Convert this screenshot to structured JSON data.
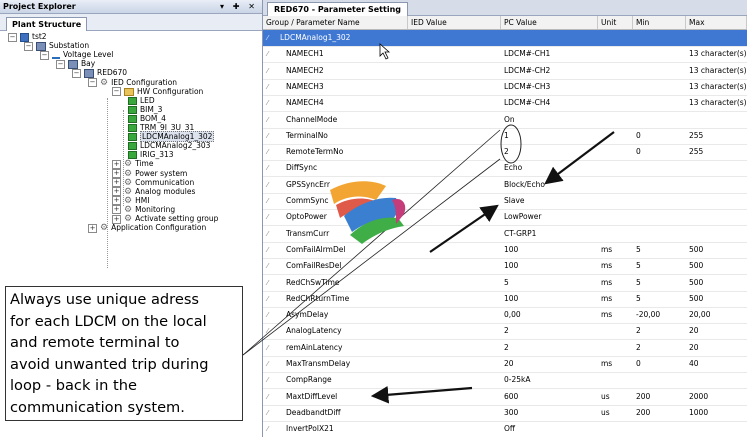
{
  "explorer": {
    "title": "Project Explorer",
    "buttons": "▾ ✚ ✕",
    "tab": "Plant Structure",
    "tree": [
      {
        "label": "tst2",
        "icon": "database-icon",
        "exp": "−"
      },
      {
        "label": "Substation",
        "icon": "substation-icon",
        "exp": "−"
      },
      {
        "label": "Voltage Level",
        "icon": "voltage-level-icon",
        "exp": "−"
      },
      {
        "label": "Bay",
        "icon": "bay-icon",
        "exp": "−"
      },
      {
        "label": "RED670",
        "icon": "ied-icon",
        "exp": "−"
      },
      {
        "label": "IED Configuration",
        "icon": "gear-icon",
        "exp": "−"
      },
      {
        "label": "HW Configuration",
        "icon": "hw-config-icon",
        "exp": "−"
      },
      {
        "label": "LED",
        "icon": "module-icon"
      },
      {
        "label": "BIM_3",
        "icon": "module-icon"
      },
      {
        "label": "BOM_4",
        "icon": "module-icon"
      },
      {
        "label": "TRM_9I_3U_31",
        "icon": "module-icon"
      },
      {
        "label": "LDCMAnalog1_302",
        "icon": "module-icon",
        "selected": true
      },
      {
        "label": "LDCMAnalog2_303",
        "icon": "module-icon"
      },
      {
        "label": "IRIG_313",
        "icon": "module-icon"
      },
      {
        "label": "Time",
        "icon": "gear-icon",
        "exp": "+"
      },
      {
        "label": "Power system",
        "icon": "gear-icon",
        "exp": "+"
      },
      {
        "label": "Communication",
        "icon": "gear-icon",
        "exp": "+"
      },
      {
        "label": "Analog modules",
        "icon": "gear-icon",
        "exp": "+"
      },
      {
        "label": "HMI",
        "icon": "gear-icon",
        "exp": "+"
      },
      {
        "label": "Monitoring",
        "icon": "gear-icon",
        "exp": "+"
      },
      {
        "label": "Activate setting group",
        "icon": "gear-icon",
        "exp": "+"
      },
      {
        "label": "Application Configuration",
        "icon": "gear-icon",
        "exp": "+"
      }
    ]
  },
  "editor": {
    "tab": "RED670 - Parameter Setting",
    "columns": [
      "Group / Parameter Name",
      "IED Value",
      "PC Value",
      "Unit",
      "Min",
      "Max"
    ],
    "group": "LDCMAnalog1_302",
    "rows": [
      [
        "NAMECH1",
        "",
        "LDCM#-CH1",
        "",
        "",
        "13 character(s)"
      ],
      [
        "NAMECH2",
        "",
        "LDCM#-CH2",
        "",
        "",
        "13 character(s)"
      ],
      [
        "NAMECH3",
        "",
        "LDCM#-CH3",
        "",
        "",
        "13 character(s)"
      ],
      [
        "NAMECH4",
        "",
        "LDCM#-CH4",
        "",
        "",
        "13 character(s)"
      ],
      [
        "ChannelMode",
        "",
        "On",
        "",
        "",
        ""
      ],
      [
        "TerminalNo",
        "",
        "1",
        "",
        "0",
        "255"
      ],
      [
        "RemoteTermNo",
        "",
        "2",
        "",
        "0",
        "255"
      ],
      [
        "DiffSync",
        "",
        "Echo",
        "",
        "",
        ""
      ],
      [
        "GPSSyncErr",
        "",
        "Block/Echo",
        "",
        "",
        ""
      ],
      [
        "CommSync",
        "",
        "Slave",
        "",
        "",
        ""
      ],
      [
        "OptoPower",
        "",
        "LowPower",
        "",
        "",
        ""
      ],
      [
        "TransmCurr",
        "",
        "CT-GRP1",
        "",
        "",
        ""
      ],
      [
        "ComFailAlrmDel",
        "",
        "100",
        "ms",
        "5",
        "500"
      ],
      [
        "ComFailResDel",
        "",
        "100",
        "ms",
        "5",
        "500"
      ],
      [
        "RedChSwTime",
        "",
        "5",
        "ms",
        "5",
        "500"
      ],
      [
        "RedChRturnTime",
        "",
        "100",
        "ms",
        "5",
        "500"
      ],
      [
        "AsymDelay",
        "",
        "0,00",
        "ms",
        "-20,00",
        "20,00"
      ],
      [
        "AnalogLatency",
        "",
        "2",
        "",
        "2",
        "20"
      ],
      [
        "remAinLatency",
        "",
        "2",
        "",
        "2",
        "20"
      ],
      [
        "MaxTransmDelay",
        "",
        "20",
        "ms",
        "0",
        "40"
      ],
      [
        "CompRange",
        "",
        "0-25kA",
        "",
        "",
        ""
      ],
      [
        "MaxtDiffLevel",
        "",
        "600",
        "us",
        "200",
        "2000"
      ],
      [
        "DeadbandtDiff",
        "",
        "300",
        "us",
        "200",
        "1000"
      ],
      [
        "InvertPolX21",
        "",
        "Off",
        "",
        "",
        ""
      ]
    ]
  },
  "callout": {
    "lines": [
      "Always use unique adress",
      "for each LDCM on the local",
      "and remote terminal to",
      "avoid unwanted trip during",
      "loop - back in the",
      "communication system."
    ]
  },
  "colors": {
    "group_row": "#3f78d3",
    "annotation_stroke": "#111111"
  }
}
